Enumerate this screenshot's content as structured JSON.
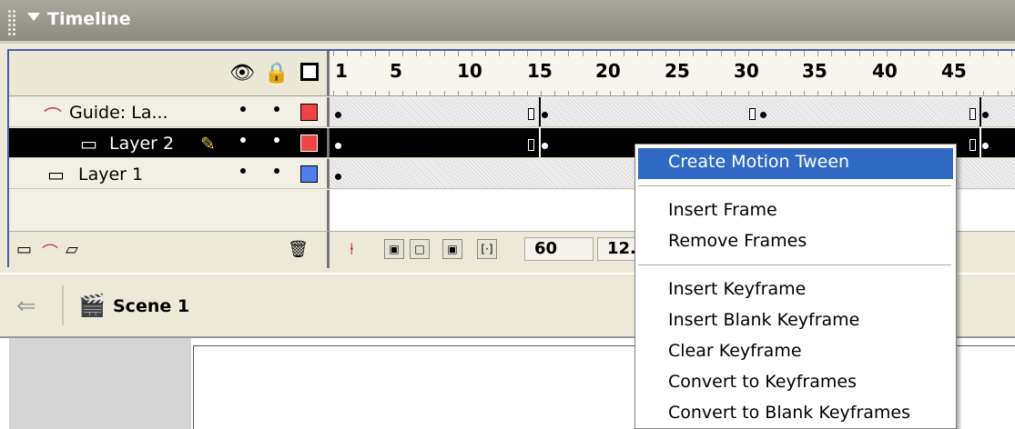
{
  "window": {
    "title": "Timeline"
  },
  "ruler": {
    "labels": [
      "1",
      "5",
      "10",
      "15",
      "20",
      "25",
      "30",
      "35",
      "40",
      "45"
    ]
  },
  "layers": [
    {
      "name": "Guide: La...",
      "color": "#ee4444",
      "selected": false
    },
    {
      "name": "Layer 2",
      "color": "#ee4444",
      "selected": true
    },
    {
      "name": "Layer 1",
      "color": "#4f7fe8",
      "selected": false
    }
  ],
  "status": {
    "current_frame": "60",
    "frame_rate": "12."
  },
  "scene": {
    "label": "Scene 1"
  },
  "context_menu": {
    "items": [
      "Create Motion Tween",
      "Insert Frame",
      "Remove Frames",
      "Insert Keyframe",
      "Insert Blank Keyframe",
      "Clear Keyframe",
      "Convert to Keyframes",
      "Convert to Blank Keyframes"
    ],
    "highlight_color": "#316ac5"
  },
  "icons": {
    "eye": "eye-icon",
    "lock": "lock-icon",
    "outline": "outline-icon",
    "guide": "guide-layer-icon",
    "layer": "layer-icon",
    "pencil": "pencil-icon",
    "trash": "trash-icon",
    "back": "back-arrow-icon",
    "scene": "scene-clapper-icon"
  }
}
